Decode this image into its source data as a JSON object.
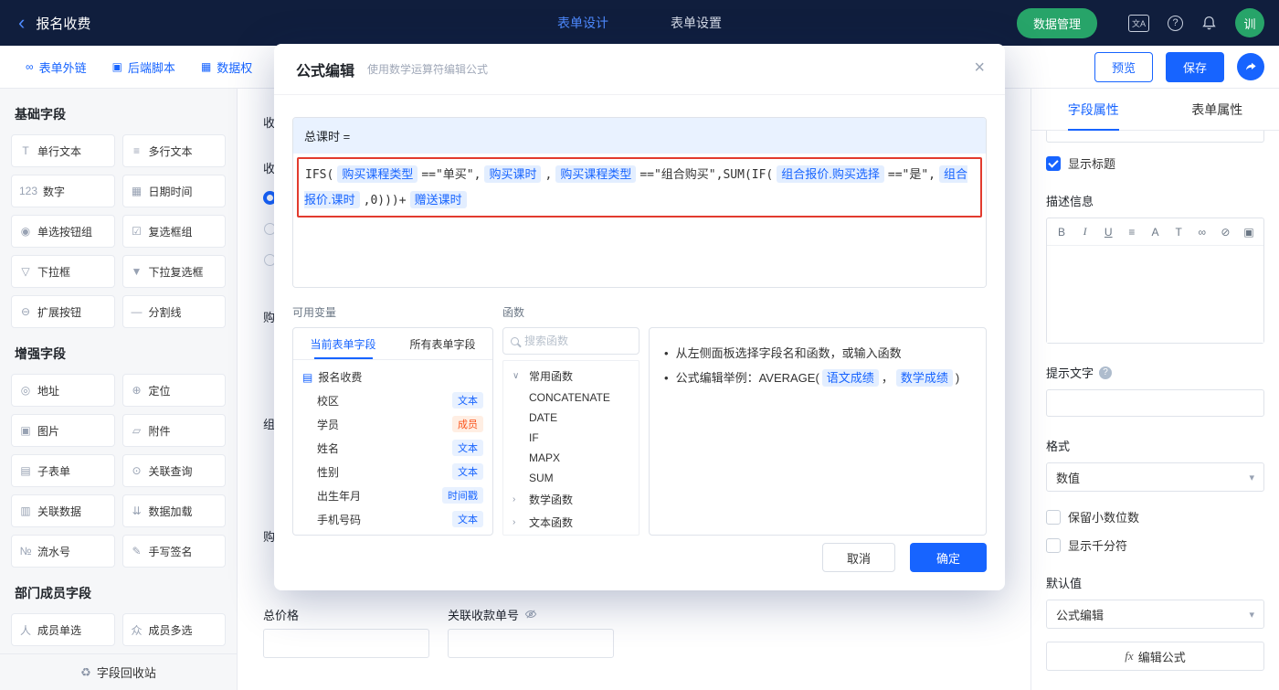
{
  "colors": {
    "primary_blue": "#1764ff",
    "topbar_bg": "#101e3d",
    "topbar_active_tab": "#4e8bff",
    "green_button": "#27a469",
    "annotation_red": "#e23b2e",
    "chip_bg": "#e3eeff",
    "tag_orange": "#fa541c",
    "formula_header_bg": "#e9f2ff"
  },
  "topbar": {
    "back_icon": "‹",
    "doc_title": "报名收费",
    "tab_design": "表单设计",
    "tab_settings": "表单设置",
    "data_manage_button": "数据管理",
    "translate_icon_text": "文A",
    "help_icon_text": "?",
    "avatar_text": "训"
  },
  "subbar": {
    "links": [
      {
        "icon": "∞",
        "label": "表单外链"
      },
      {
        "icon": "▣",
        "label": "后端脚本"
      },
      {
        "icon": "▦",
        "label": "数据权"
      }
    ],
    "preview_button": "预览",
    "save_button": "保存"
  },
  "sidebar": {
    "basic": {
      "title": "基础字段",
      "items": [
        {
          "icon": "T",
          "label": "单行文本"
        },
        {
          "icon": "≡",
          "label": "多行文本"
        },
        {
          "icon": "123",
          "label": "数字"
        },
        {
          "icon": "▦",
          "label": "日期时间"
        },
        {
          "icon": "◉",
          "label": "单选按钮组"
        },
        {
          "icon": "☑",
          "label": "复选框组"
        },
        {
          "icon": "▽",
          "label": "下拉框"
        },
        {
          "icon": "▼",
          "label": "下拉复选框"
        },
        {
          "icon": "⊖",
          "label": "扩展按钮"
        },
        {
          "icon": "—",
          "label": "分割线"
        }
      ]
    },
    "enhanced": {
      "title": "增强字段",
      "items": [
        {
          "icon": "◎",
          "label": "地址"
        },
        {
          "icon": "⊕",
          "label": "定位"
        },
        {
          "icon": "▣",
          "label": "图片"
        },
        {
          "icon": "▱",
          "label": "附件"
        },
        {
          "icon": "▤",
          "label": "子表单"
        },
        {
          "icon": "⊙",
          "label": "关联查询"
        },
        {
          "icon": "▥",
          "label": "关联数据"
        },
        {
          "icon": "⇊",
          "label": "数据加载"
        },
        {
          "icon": "№",
          "label": "流水号"
        },
        {
          "icon": "✎",
          "label": "手写签名"
        }
      ]
    },
    "member": {
      "title": "部门成员字段",
      "items": [
        {
          "icon": "人",
          "label": "成员单选"
        },
        {
          "icon": "众",
          "label": "成员多选"
        }
      ]
    },
    "recycle_icon": "♻",
    "recycle_label": "字段回收站"
  },
  "canvas": {
    "fragments": [
      "收",
      "收",
      "购",
      "组",
      "购"
    ],
    "total_price_label": "总价格",
    "related_receipt_label": "关联收款单号"
  },
  "properties": {
    "tab_field": "字段属性",
    "tab_form": "表单属性",
    "show_title_label": "显示标题",
    "description_label": "描述信息",
    "editor_tools": [
      "B",
      "I",
      "U",
      "≡",
      "A",
      "T",
      "∞",
      "⊘",
      "▣"
    ],
    "hint_label": "提示文字",
    "hint_help_icon": "?",
    "format_label": "格式",
    "format_value": "数值",
    "chevron_down": "▾",
    "keep_decimals_label": "保留小数位数",
    "thousands_label": "显示千分符",
    "default_label": "默认值",
    "default_value": "公式编辑",
    "fx_prefix": "fx",
    "edit_formula_button": "编辑公式"
  },
  "modal": {
    "title": "公式编辑",
    "subtitle": "使用数学运算符编辑公式",
    "close_icon": "×",
    "formula_lhs": "总课时 =",
    "formula_tokens": [
      {
        "t": "text",
        "v": "IFS("
      },
      {
        "t": "field",
        "v": "购买课程类型"
      },
      {
        "t": "text",
        "v": "==\"单买\","
      },
      {
        "t": "field",
        "v": "购买课时"
      },
      {
        "t": "text",
        "v": ","
      },
      {
        "t": "field",
        "v": "购买课程类型"
      },
      {
        "t": "text",
        "v": "==\"组合购买\",SUM(IF("
      },
      {
        "t": "field",
        "v": "组合报价.购买选择"
      },
      {
        "t": "text",
        "v": "==\"是\","
      },
      {
        "t": "field",
        "v": "组合报价.课时"
      },
      {
        "t": "text",
        "v": ",0)))+"
      },
      {
        "t": "field",
        "v": "赠送课时"
      }
    ],
    "variables": {
      "label": "可用变量",
      "tab_current": "当前表单字段",
      "tab_all": "所有表单字段",
      "form_icon": "▤",
      "form_name": "报名收费",
      "fields": [
        {
          "name": "校区",
          "tag": "文本",
          "color": "blue"
        },
        {
          "name": "学员",
          "tag": "成员",
          "color": "orange"
        },
        {
          "name": "姓名",
          "tag": "文本",
          "color": "blue"
        },
        {
          "name": "性别",
          "tag": "文本",
          "color": "blue"
        },
        {
          "name": "出生年月",
          "tag": "时间戳",
          "color": "blue"
        },
        {
          "name": "手机号码",
          "tag": "文本",
          "color": "blue"
        }
      ]
    },
    "functions": {
      "label": "函数",
      "search_placeholder": "搜索函数",
      "items": [
        {
          "type": "group",
          "chev": "∨",
          "name": "常用函数"
        },
        {
          "type": "fn",
          "name": "CONCATENATE"
        },
        {
          "type": "fn",
          "name": "DATE"
        },
        {
          "type": "fn",
          "name": "IF"
        },
        {
          "type": "fn",
          "name": "MAPX"
        },
        {
          "type": "fn",
          "name": "SUM"
        },
        {
          "type": "group",
          "chev": "›",
          "name": "数学函数"
        },
        {
          "type": "group",
          "chev": "›",
          "name": "文本函数"
        }
      ]
    },
    "help": {
      "bullet": "•",
      "line1": "从左侧面板选择字段名和函数，或输入函数",
      "line2_prefix": "公式编辑举例：AVERAGE(",
      "chip1": "语文成绩",
      "line2_separator": "，",
      "chip2": "数学成绩",
      "line2_suffix": ")"
    },
    "cancel_button": "取消",
    "ok_button": "确定"
  }
}
